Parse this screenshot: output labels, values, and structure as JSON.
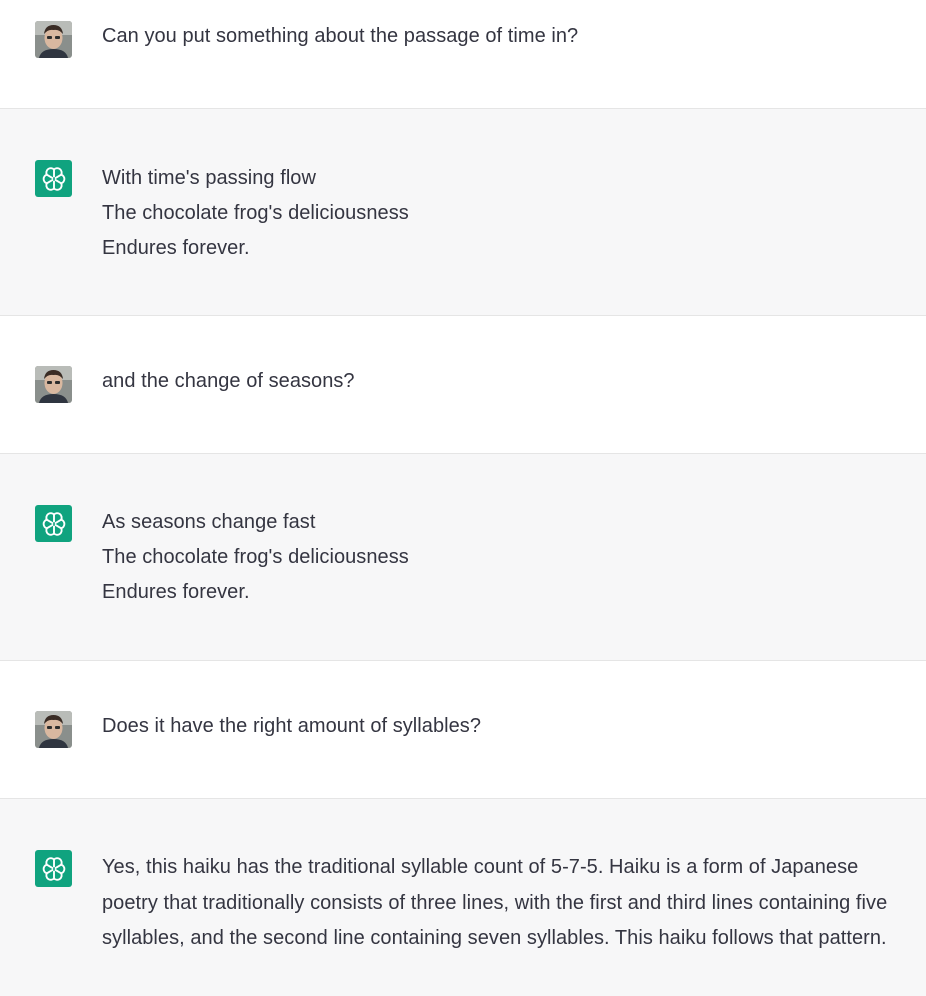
{
  "conversation": {
    "messages": [
      {
        "role": "user",
        "avatar": "user-photo",
        "lines": [
          "Can you put something about the passage of time in?"
        ]
      },
      {
        "role": "assistant",
        "avatar": "openai-logo-icon",
        "lines": [
          "With time's passing flow",
          "The chocolate frog's deliciousness",
          "Endures forever."
        ]
      },
      {
        "role": "user",
        "avatar": "user-photo",
        "lines": [
          "and the change of seasons?"
        ]
      },
      {
        "role": "assistant",
        "avatar": "openai-logo-icon",
        "lines": [
          "As seasons change fast",
          "The chocolate frog's deliciousness",
          "Endures forever."
        ]
      },
      {
        "role": "user",
        "avatar": "user-photo",
        "lines": [
          "Does it have the right amount of syllables?"
        ]
      },
      {
        "role": "assistant",
        "avatar": "openai-logo-icon",
        "lines": [
          "Yes, this haiku has the traditional syllable count of 5-7-5. Haiku is a form of Japanese poetry that traditionally consists of three lines, with the first and third lines containing five syllables, and the second line containing seven syllables. This haiku follows that pattern."
        ]
      }
    ]
  },
  "colors": {
    "assistant_bg": "#f7f7f8",
    "user_bg": "#ffffff",
    "accent": "#10a37f",
    "text": "#343541",
    "divider": "#e5e5e5"
  }
}
